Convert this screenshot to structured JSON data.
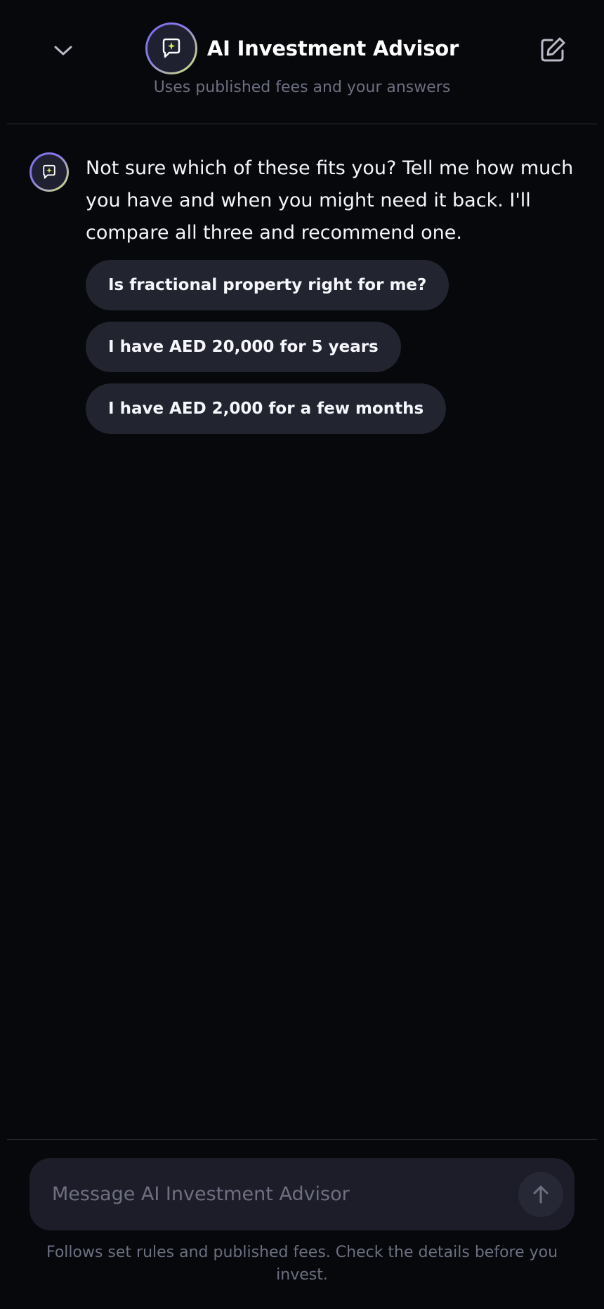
{
  "header": {
    "title": "AI Investment Advisor",
    "subtitle": "Uses published fees and your answers"
  },
  "message": {
    "text": "Not sure which of these fits you? Tell me how much you have and when you might need it back. I'll compare all three and recommend one."
  },
  "suggestions": [
    {
      "label": "Is fractional property right for me?"
    },
    {
      "label": "I have AED 20,000 for 5 years"
    },
    {
      "label": "I have AED 2,000 for a few months"
    }
  ],
  "composer": {
    "value": "",
    "placeholder": "Message AI Investment Advisor"
  },
  "disclaimer": "Follows set rules and published fees. Check the details before you invest.",
  "icons": {
    "collapse": "chevron-down-icon",
    "new_chat": "edit-icon",
    "advisor": "sparkle-chat-icon",
    "send": "arrow-up-icon"
  },
  "colors": {
    "background": "#07080c",
    "chip": "#222430",
    "accent_purple": "#7c6cf0",
    "accent_lime": "#d7ef6a"
  }
}
